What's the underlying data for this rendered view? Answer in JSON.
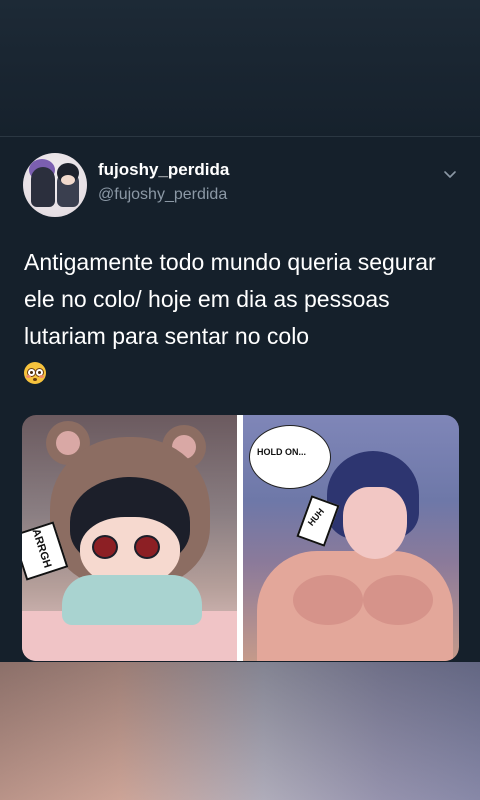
{
  "tweet": {
    "display_name": "fujoshy_perdida",
    "handle": "@fujoshy_perdida",
    "text": "Antigamente todo mundo queria segurar ele no colo/ hoje em dia as pessoas lutariam para sentar no colo",
    "emoji": "flushed-face"
  },
  "media": {
    "left_panel_sfx": "ARRGH",
    "right_panel_bubble": "HOLD ON...",
    "right_panel_sfx": "HUH"
  },
  "colors": {
    "background": "#15202b",
    "primary_text": "#ffffff",
    "secondary_text": "#8b98a5"
  }
}
